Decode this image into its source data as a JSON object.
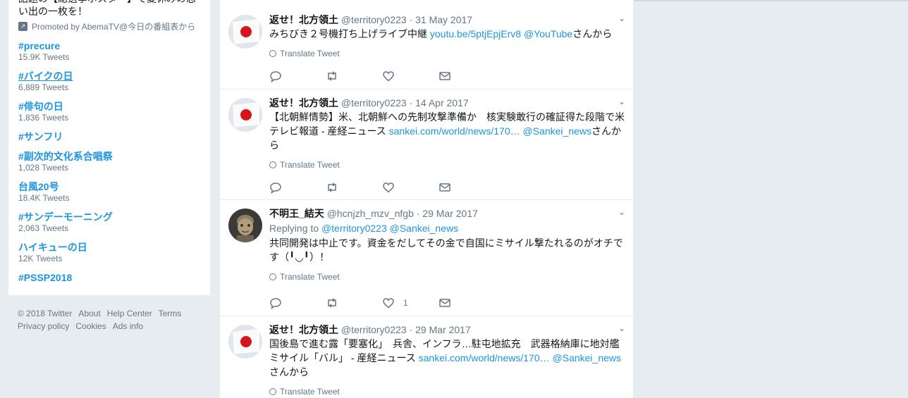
{
  "trends_panel": {
    "promo_text": "話題の【総選挙ポスター】で夏休みの思い出の一枚を！",
    "promoted_label": "Promoted by AbemaTV@今日の番組表から",
    "items": [
      {
        "name": "#precure",
        "count": "15.9K Tweets"
      },
      {
        "name": "#バイクの日",
        "count": "6,889 Tweets"
      },
      {
        "name": "#俳句の日",
        "count": "1,836 Tweets"
      },
      {
        "name": "#サンフリ",
        "count": ""
      },
      {
        "name": "#副次的文化系合唱祭",
        "count": "1,028 Tweets"
      },
      {
        "name": "台風20号",
        "count": "18.4K Tweets"
      },
      {
        "name": "#サンデーモーニング",
        "count": "2,063 Tweets"
      },
      {
        "name": "ハイキューの日",
        "count": "12K Tweets"
      },
      {
        "name": "#PSSP2018",
        "count": ""
      }
    ]
  },
  "footer": {
    "links": [
      "© 2018 Twitter",
      "About",
      "Help Center",
      "Terms",
      "Privacy policy",
      "Cookies",
      "Ads info"
    ]
  },
  "tweets": [
    {
      "name": "返せ！北方領土",
      "meta": "@territory0223 · 31 May 2017",
      "text_parts": [
        "みちびき２号機打ち上げライブ中継 ",
        "youtu.be/5ptjEpjErv8",
        " ",
        "@YouTube",
        "さんから"
      ],
      "translate": "Translate Tweet",
      "like_count": ""
    },
    {
      "name": "返せ！北方領土",
      "meta": "@territory0223 · 14 Apr 2017",
      "text_parts": [
        "【北朝鮮情勢】米、北朝鮮への先制攻撃準備か　核実験敢行の確証得た段階で米テレビ報道 - 産経ニュース ",
        "sankei.com/world/news/170…",
        " ",
        "@Sankei_news",
        "さんから"
      ],
      "translate": "Translate Tweet",
      "like_count": ""
    },
    {
      "name": "不明王_結天",
      "meta": "@hcnjzh_mzv_nfgb · 29 Mar 2017",
      "reply_label": "Replying to ",
      "reply_to": "@territory0223 @Sankei_news",
      "text_parts": [
        "共同開発は中止です。資金をだしてその金で自国にミサイル撃たれるのがオチです（╹◡╹）！",
        "",
        "",
        "",
        ""
      ],
      "translate": "Translate Tweet",
      "like_count": "1"
    },
    {
      "name": "返せ！北方領土",
      "meta": "@territory0223 · 29 Mar 2017",
      "text_parts": [
        "国後島で進む露「要塞化」　兵舎、インフラ…駐屯地拡充　武器格納庫に地対艦ミサイル「バル」 - 産経ニュース ",
        "sankei.com/world/news/170…",
        " ",
        "@Sankei_news",
        "さんから"
      ],
      "translate": "Translate Tweet",
      "like_count": ""
    }
  ],
  "icons": {
    "reply": "reply-icon",
    "retweet": "retweet-icon",
    "like": "heart-icon",
    "dm": "envelope-icon",
    "caret": "chevron-down-icon",
    "globe": "globe-icon",
    "promoted": "promoted-arrow-icon"
  },
  "colors": {
    "link": "#1b95e0",
    "muted": "#657786",
    "background": "#e6ecf0"
  }
}
